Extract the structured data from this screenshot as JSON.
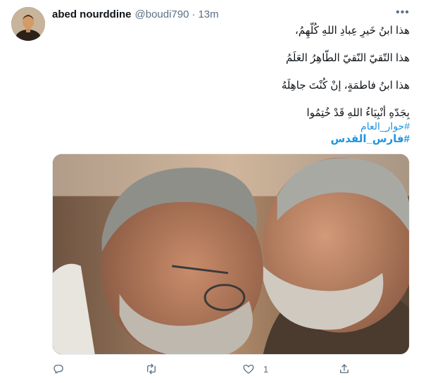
{
  "tweet": {
    "author_name": "abed nourddine",
    "author_handle": "@boudi790",
    "separator": "·",
    "time": "13m",
    "more_label": "•••",
    "lines": [
      "هذا ابنُ خَيرِ عِبادِ اللهِ كُلّهِمُ،",
      "هذا التّقيّ النّقيّ الطّاهِرُ العَلَمُ",
      "هذا ابنُ فاطمَةٍ، إنْ كُنْتَ جاهِلَهُ",
      "بِجَدّهِ أنْبِيَاءُ اللهِ قَدْ خُتِمُوا"
    ],
    "hashtags": [
      "#حوار_العام",
      "#فارس_القدس"
    ],
    "like_count": "1"
  },
  "icons": {
    "reply": "reply-icon",
    "retweet": "retweet-icon",
    "like": "heart-icon",
    "share": "share-icon",
    "more": "more-options-icon"
  },
  "colors": {
    "link": "#1b95e0",
    "secondary_text": "#5b7083",
    "primary_text": "#0f1419"
  }
}
